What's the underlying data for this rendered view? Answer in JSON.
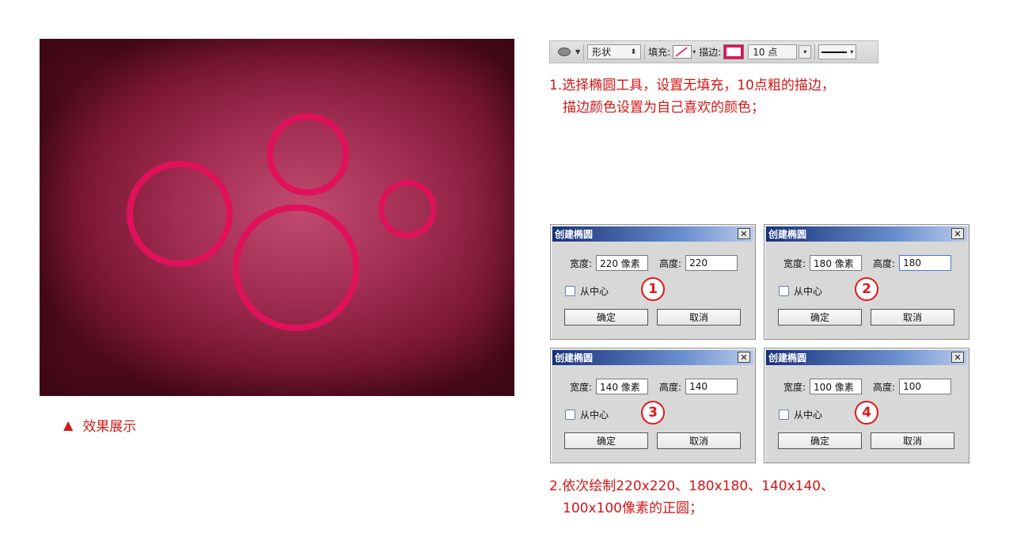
{
  "caption": {
    "marker": "▲",
    "text": "效果展示"
  },
  "colors": {
    "accent": "#e0115a",
    "annotation": "#d41515"
  },
  "optbar": {
    "shape_mode": "形状",
    "fill_label": "填充:",
    "stroke_label": "描边:",
    "stroke_size": "10 点"
  },
  "instructions": {
    "step1_line1": "1.选择椭圆工具，设置无填充，10点粗的描边，",
    "step1_line2": "描边颜色设置为自己喜欢的颜色；",
    "step2_line1": "2.依次绘制220x220、180x180、140x140、",
    "step2_line2": "100x100像素的正圆；"
  },
  "dialogs": [
    {
      "title": "创建椭圆",
      "width_label": "宽度:",
      "width_value": "220 像素",
      "height_label": "高度:",
      "height_value": "220",
      "center_label": "从中心",
      "badge": "1",
      "ok": "确定",
      "cancel": "取消"
    },
    {
      "title": "创建椭圆",
      "width_label": "宽度:",
      "width_value": "180 像素",
      "height_label": "高度:",
      "height_value": "180",
      "center_label": "从中心",
      "badge": "2",
      "ok": "确定",
      "cancel": "取消"
    },
    {
      "title": "创建椭圆",
      "width_label": "宽度:",
      "width_value": "140 像素",
      "height_label": "高度:",
      "height_value": "140",
      "center_label": "从中心",
      "badge": "3",
      "ok": "确定",
      "cancel": "取消"
    },
    {
      "title": "创建椭圆",
      "width_label": "宽度:",
      "width_value": "100 像素",
      "height_label": "高度:",
      "height_value": "100",
      "center_label": "从中心",
      "badge": "4",
      "ok": "确定",
      "cancel": "取消"
    }
  ]
}
